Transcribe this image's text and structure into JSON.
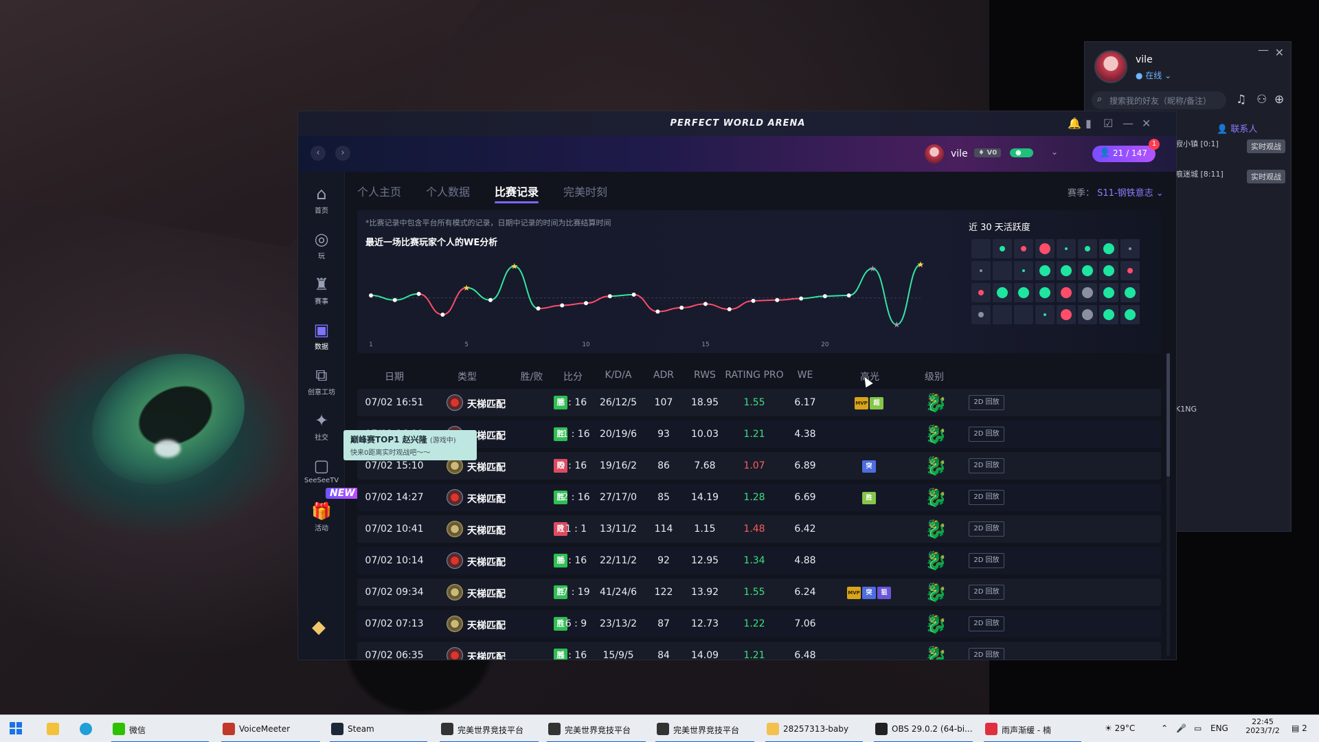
{
  "friend_panel": {
    "username": "vile",
    "status": "在线",
    "search_placeholder": "搜索我的好友（昵称/备注）",
    "contacts_label": "联系人",
    "icons": [
      "headset-icon",
      "add-friend-icon",
      "search-plus-icon"
    ],
    "list_items": [
      {
        "text": "寂小镇 [0:1]",
        "badge": "实时观战"
      },
      {
        "text": "痕迷城 [8:11]",
        "badge": "实时观战"
      },
      {
        "text": "",
        "badge": ""
      },
      {
        "text": "",
        "badge": ""
      },
      {
        "text": "",
        "badge": ""
      },
      {
        "text": "",
        "badge": ""
      },
      {
        "text": "",
        "badge": ""
      },
      {
        "text": "",
        "badge": ""
      },
      {
        "text": "K1NG",
        "badge": ""
      }
    ]
  },
  "window": {
    "title": "PERFECT WORLD ARENA"
  },
  "topbar": {
    "username": "vile",
    "vip_level": "V0",
    "friends_count": "21 / 147",
    "notification_count": "1"
  },
  "sidebar": {
    "items": [
      {
        "label": "首页",
        "icon": "home-icon"
      },
      {
        "label": "玩",
        "icon": "gamepad-icon"
      },
      {
        "label": "赛事",
        "icon": "trophy-icon"
      },
      {
        "label": "数据",
        "icon": "chart-icon",
        "active": true
      },
      {
        "label": "创意工坊",
        "icon": "workshop-icon"
      },
      {
        "label": "社交",
        "icon": "social-icon"
      },
      {
        "label": "SeeSeeTV",
        "icon": "tv-icon"
      },
      {
        "label": "活动",
        "icon": "gift-icon"
      }
    ],
    "new_badge": "NEW"
  },
  "tooltip": {
    "title": "巅峰赛TOP1 赵兴隆",
    "title_suffix": "(游戏中)",
    "subtitle": "快来0距离实时观战吧～～"
  },
  "tabs": [
    {
      "label": "个人主页",
      "active": false
    },
    {
      "label": "个人数据",
      "active": false
    },
    {
      "label": "比赛记录",
      "active": true
    },
    {
      "label": "完美时刻",
      "active": false
    }
  ],
  "season": {
    "label": "赛季：",
    "value": "S11-钢铁意志"
  },
  "chart_panel": {
    "note": "*比赛记录中包含平台所有模式的记录，日期中记录的时间为比赛结算时间",
    "title": "最近一场比赛玩家个人的WE分析",
    "activity_title": "近 30 天活跃度"
  },
  "chart_data": {
    "type": "line",
    "title": "最近一场比赛玩家个人的WE分析",
    "x": [
      1,
      2,
      3,
      4,
      5,
      6,
      7,
      8,
      9,
      10,
      11,
      12,
      13,
      14,
      15,
      16,
      17,
      18,
      19,
      20,
      21,
      22,
      23
    ],
    "x_ticks": [
      1,
      5,
      10,
      15,
      20
    ],
    "y": [
      8.0,
      7.4,
      8.2,
      5.5,
      9.0,
      7.4,
      11.8,
      6.3,
      6.7,
      7.0,
      7.9,
      8.1,
      5.9,
      6.4,
      6.9,
      6.2,
      7.3,
      7.4,
      7.6,
      7.9,
      8.0,
      11.5,
      4.2,
      12.0
    ],
    "star_points": [
      5,
      7,
      22,
      24
    ],
    "grey_star_points": [
      22,
      23
    ],
    "ylim": [
      3,
      13
    ]
  },
  "activity": {
    "cells": [
      [
        "none",
        "green-s",
        "red-s",
        "red-l",
        "green-xs",
        "green-s",
        "green-l",
        "grey-xs"
      ],
      [
        "grey-xs",
        "none",
        "green-xs",
        "green-l",
        "green-l",
        "green-l",
        "green-l",
        "red-s"
      ],
      [
        "red-s",
        "green-l",
        "green-l",
        "green-l",
        "red-l",
        "grey-l",
        "green-l",
        "green-l"
      ],
      [
        "grey-s",
        "none",
        "none",
        "green-xs",
        "red-l",
        "grey-l",
        "green-l",
        "green-l"
      ]
    ],
    "colors": {
      "green": "#1ee6a0",
      "red": "#ff4d6a",
      "grey": "#8b8f9e"
    }
  },
  "table": {
    "headers": [
      "日期",
      "类型",
      "胜/败",
      "比分",
      "K/D/A",
      "ADR",
      "RWS",
      "RATING PRO",
      "WE",
      "高光",
      "级别"
    ],
    "replay_label": "2D 回放",
    "rows": [
      {
        "date": "07/02 16:51",
        "type": "天梯匹配",
        "icon": "ladder",
        "result": "胜",
        "win": true,
        "score": "8 : 16",
        "kda": "26/12/5",
        "adr": "107",
        "rws": "18.95",
        "rating": "1.55",
        "we": "6.17",
        "highlights": [
          {
            "t": "MVP",
            "c": "mvp"
          },
          {
            "t": "超",
            "c": "green"
          }
        ]
      },
      {
        "date": "07/02 16:19",
        "type": "天梯匹配",
        "icon": "ladder",
        "result": "胜",
        "win": true,
        "score": "11 : 16",
        "kda": "20/19/6",
        "adr": "93",
        "rws": "10.03",
        "rating": "1.21",
        "we": "4.38",
        "highlights": []
      },
      {
        "date": "07/02 15:10",
        "type": "天梯匹配",
        "icon": "coin",
        "result": "败",
        "win": false,
        "score": "9 : 16",
        "kda": "19/16/2",
        "adr": "86",
        "rws": "7.68",
        "rating": "1.07",
        "we": "6.89",
        "highlights": [
          {
            "t": "突",
            "c": "blue"
          }
        ]
      },
      {
        "date": "07/02 14:27",
        "type": "天梯匹配",
        "icon": "ladder",
        "result": "胜",
        "win": true,
        "score": "12 : 16",
        "kda": "27/17/0",
        "adr": "85",
        "rws": "14.19",
        "rating": "1.28",
        "we": "6.69",
        "highlights": [
          {
            "t": "胜",
            "c": "green"
          }
        ]
      },
      {
        "date": "07/02 10:41",
        "type": "天梯匹配",
        "icon": "coin",
        "result": "败",
        "win": false,
        "score": "11 : 1",
        "kda": "13/11/2",
        "adr": "114",
        "rws": "1.15",
        "rating": "1.48",
        "we": "6.42",
        "highlights": []
      },
      {
        "date": "07/02 10:14",
        "type": "天梯匹配",
        "icon": "ladder",
        "result": "胜",
        "win": true,
        "score": "6 : 16",
        "kda": "22/11/2",
        "adr": "92",
        "rws": "12.95",
        "rating": "1.34",
        "we": "4.88",
        "highlights": []
      },
      {
        "date": "07/02 09:34",
        "type": "天梯匹配",
        "icon": "coin",
        "result": "胜",
        "win": true,
        "score": "17 : 19",
        "kda": "41/24/6",
        "adr": "122",
        "rws": "13.92",
        "rating": "1.55",
        "we": "6.24",
        "highlights": [
          {
            "t": "MVP",
            "c": "mvp"
          },
          {
            "t": "突",
            "c": "blue"
          },
          {
            "t": "狙",
            "c": "purple"
          }
        ]
      },
      {
        "date": "07/02 07:13",
        "type": "天梯匹配",
        "icon": "coin",
        "result": "胜",
        "win": true,
        "score": "16 : 9",
        "kda": "23/13/2",
        "adr": "87",
        "rws": "12.73",
        "rating": "1.22",
        "we": "7.06",
        "highlights": []
      },
      {
        "date": "07/02 06:35",
        "type": "天梯匹配",
        "icon": "ladder",
        "result": "胜",
        "win": true,
        "score": "4 : 16",
        "kda": "15/9/5",
        "adr": "84",
        "rws": "14.09",
        "rating": "1.21",
        "we": "6.48",
        "highlights": []
      }
    ]
  },
  "taskbar": {
    "items": [
      {
        "label": "微信",
        "color": "#2dc100"
      },
      {
        "label": "VoiceMeeter",
        "color": "#c0392b"
      },
      {
        "label": "Steam",
        "color": "#1b2838"
      },
      {
        "label": "完美世界竞技平台",
        "color": "#333"
      },
      {
        "label": "完美世界竞技平台",
        "color": "#333"
      },
      {
        "label": "完美世界竞技平台",
        "color": "#333"
      },
      {
        "label": "28257313-baby",
        "color": "#f2c14e"
      },
      {
        "label": "OBS 29.0.2 (64-bi...",
        "color": "#222"
      },
      {
        "label": "雨声渐缓 - 楠",
        "color": "#e0303e"
      }
    ],
    "weather": "29°C",
    "language": "ENG",
    "time": "22:45",
    "date": "2023/7/2",
    "notification_count": "2"
  }
}
